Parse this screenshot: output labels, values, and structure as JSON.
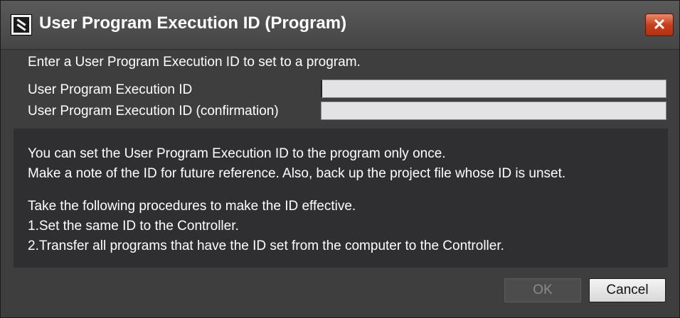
{
  "window": {
    "title": "User Program Execution ID (Program)",
    "close_symbol": "✕",
    "app_icon": "app-icon",
    "close_icon": "close-icon"
  },
  "form": {
    "prompt": "Enter a User Program Execution ID to set to a program.",
    "id_label": "User Program Execution ID",
    "id_value": "",
    "confirm_label": "User Program Execution ID (confirmation)",
    "confirm_value": ""
  },
  "info": {
    "line1": "You can set the User Program Execution ID to the program only once.",
    "line2": "Make a note of the ID for future reference. Also, back up the project file whose ID is unset.",
    "line3": "Take the following procedures to make the ID effective.",
    "line4": "1.Set the same ID to the Controller.",
    "line5": "2.Transfer all programs that have the ID set from the computer to the Controller."
  },
  "buttons": {
    "ok_label": "OK",
    "ok_enabled": false,
    "cancel_label": "Cancel"
  },
  "colors": {
    "close_button": "#c8401e",
    "dialog_background": "#3e3e3e",
    "info_panel": "#2f2f31"
  }
}
